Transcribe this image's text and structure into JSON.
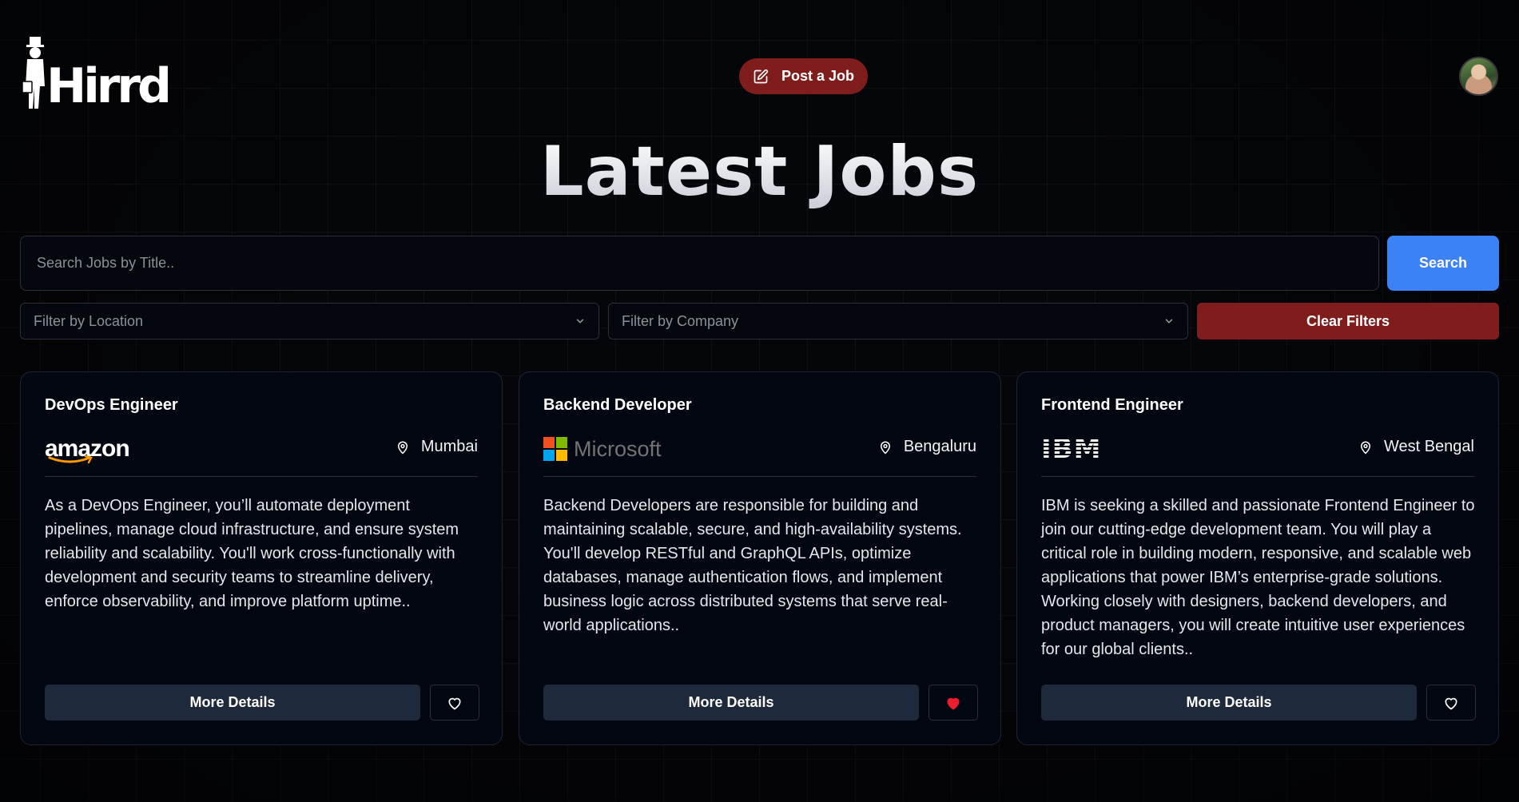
{
  "header": {
    "logo_text": "Hirrd",
    "post_job_label": "Post a Job"
  },
  "page_title": "Latest Jobs",
  "search": {
    "placeholder": "Search Jobs by Title..",
    "button_label": "Search"
  },
  "filters": {
    "location_placeholder": "Filter by Location",
    "company_placeholder": "Filter by Company",
    "clear_label": "Clear Filters"
  },
  "jobs": [
    {
      "title": "DevOps Engineer",
      "company": "amazon",
      "location": "Mumbai",
      "description": "As a DevOps Engineer, you’ll automate deployment pipelines, manage cloud infrastructure, and ensure system reliability and scalability. You'll work cross-functionally with development and security teams to streamline delivery, enforce observability, and improve platform uptime..",
      "more_label": "More Details",
      "saved": false
    },
    {
      "title": "Backend Developer",
      "company": "Microsoft",
      "location": "Bengaluru",
      "description": "Backend Developers are responsible for building and maintaining scalable, secure, and high-availability systems. You'll develop RESTful and GraphQL APIs, optimize databases, manage authentication flows, and implement business logic across distributed systems that serve real-world applications..",
      "more_label": "More Details",
      "saved": true
    },
    {
      "title": "Frontend Engineer",
      "company": "IBM",
      "location": "West Bengal",
      "description": "IBM is seeking a skilled and passionate Frontend Engineer to join our cutting-edge development team. You will play a critical role in building modern, responsive, and scalable web applications that power IBM’s enterprise-grade solutions. Working closely with designers, backend developers, and product managers, you will create intuitive user experiences for our global clients..",
      "more_label": "More Details",
      "saved": false
    }
  ],
  "colors": {
    "accent_red": "#7f1d1d",
    "accent_blue": "#3b82f6",
    "heart_saved": "#ef1c2e"
  }
}
